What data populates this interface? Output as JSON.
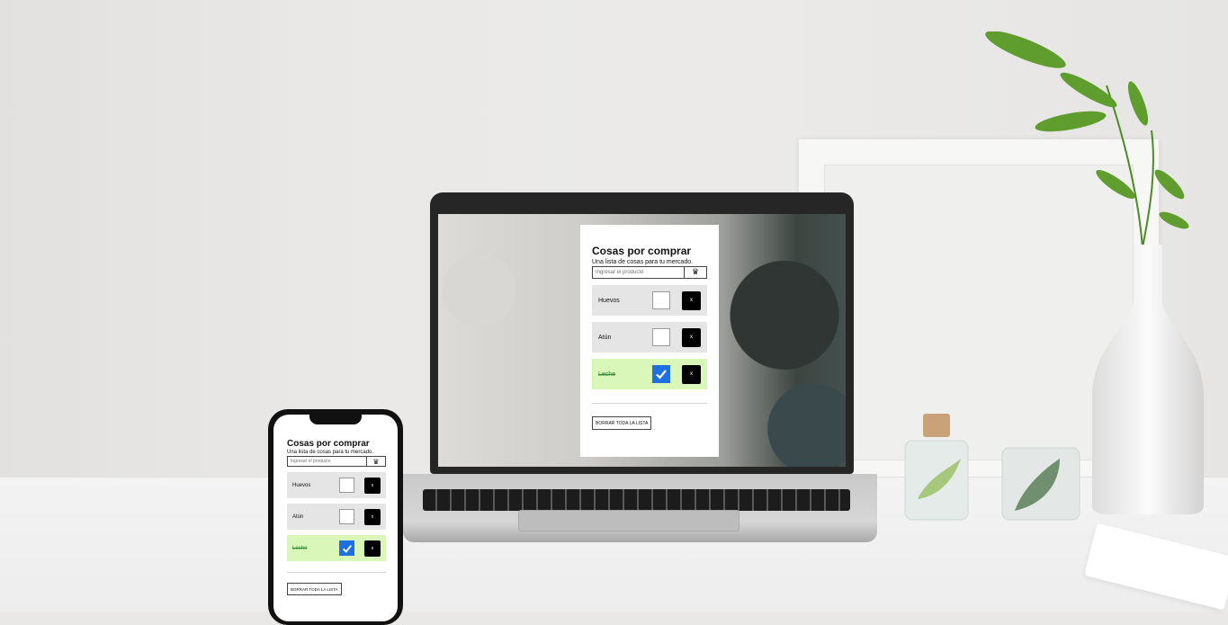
{
  "app": {
    "title": "Cosas por comprar",
    "subtitle": "Una lista de cosas para tu mercado.",
    "input_placeholder": "Ingresar el producto",
    "add_icon": "basket-icon",
    "items": [
      {
        "label": "Huevos",
        "checked": false,
        "delete_label": "x"
      },
      {
        "label": "Atún",
        "checked": false,
        "delete_label": "x"
      },
      {
        "label": "Leche",
        "checked": true,
        "delete_label": "x"
      }
    ],
    "clear_label": "BORRAR TODA LA LISTA"
  },
  "colors": {
    "item_background": "#e5e5e5",
    "item_done_background": "#d8f7b8",
    "done_text": "#2f8b2f",
    "checkbox_checked": "#1f6fe0",
    "delete_button": "#000000"
  },
  "devices": [
    "laptop",
    "phone"
  ]
}
